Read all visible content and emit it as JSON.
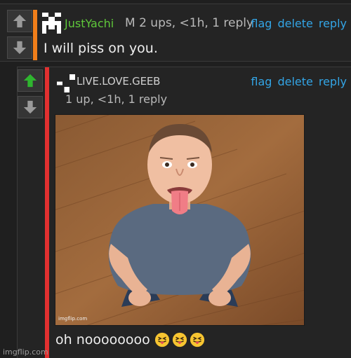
{
  "comments": [
    {
      "username": "JustYachi",
      "meta": "M   2 ups, <1h, 1 reply",
      "actions": [
        "flag",
        "delete",
        "reply"
      ],
      "text": "I will piss on you.",
      "upvoted": false,
      "accent_color": "#f07e1a"
    },
    {
      "username": "LIVE.LOVE.GEEB",
      "meta": "1 up, <1h, 1 reply",
      "actions": [
        "flag",
        "delete",
        "reply"
      ],
      "upvoted": true,
      "accent_color": "#e23030",
      "image": {
        "subject": "man-with-tongue-out",
        "watermark": "imgflip.com"
      },
      "caption": "oh noooooooo",
      "caption_emojis": [
        "tongue-face-emoji",
        "tongue-face-emoji",
        "tongue-face-emoji"
      ]
    }
  ],
  "colors": {
    "upvote_active": "#2fb52f",
    "vote_inactive": "#9a9a9a",
    "link": "#33a5e6",
    "username_green": "#5fc83a"
  },
  "site_watermark": "imgflip.com"
}
